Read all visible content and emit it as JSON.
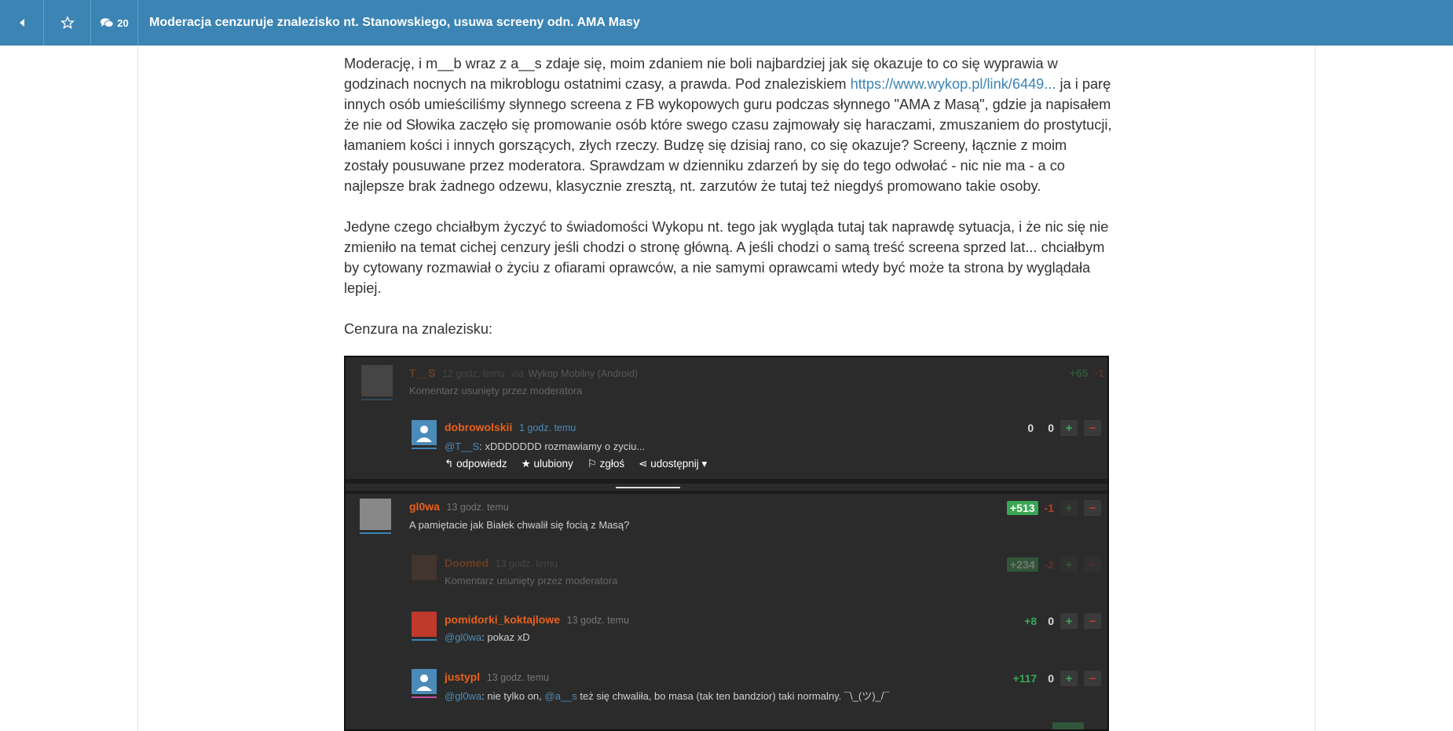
{
  "topbar": {
    "comment_count": "20",
    "title": "Moderacja cenzuruje znalezisko nt. Stanowskiego, usuwa screeny odn. AMA Masy"
  },
  "article": {
    "p1_a": "Moderację, i m__b wraz z a__s zdaje się, moim zdaniem nie boli najbardziej jak się okazuje to co się wyprawia w godzinach nocnych na mikroblogu ostatnimi czasy, a prawda. Pod znaleziskiem ",
    "p1_link": "https://www.wykop.pl/link/6449...",
    "p1_b": " ja i parę innych osób umieściliśmy słynnego screena z FB wykopowych guru podczas słynnego \"AMA z Masą\", gdzie ja napisałem że nie od Słowika zaczęło się promowanie osób które swego czasu zajmowały się haraczami, zmuszaniem do prostytucji, łamaniem kości i innych gorszących, złych rzeczy. Budzę się dzisiaj rano, co się okazuje? Screeny, łącznie z moim zostały pousuwane przez moderatora. Sprawdzam w dzienniku zdarzeń by się do tego odwołać - nic nie ma - a co najlepsze brak żadnego odzewu, klasycznie zresztą, nt. zarzutów że tutaj też niegdyś promowano takie osoby.",
    "p2": "Jedyne czego chciałbym życzyć to świadomości Wykopu nt. tego jak wygląda tutaj tak naprawdę sytuacja, i że nic się nie zmieniło na temat cichej cenzury jeśli chodzi o stronę główną. A jeśli chodzi o samą treść screena sprzed lat... chciałbym by cytowany rozmawiał o życiu z ofiarami oprawców, a nie samymi oprawcami wtedy być może ta strona by wyglądała lepiej.",
    "p3": "Cenzura na znalezisku:"
  },
  "screenshot": {
    "c1": {
      "nick": "T__S",
      "time": "12 godz. temu",
      "via": "via",
      "app": "Wykop Mobilny (Android)",
      "body": "Komentarz usunięty przez moderatora",
      "plus": "+65",
      "minus": "-1"
    },
    "c2": {
      "nick": "dobrowolskii",
      "time": "1 godz. temu",
      "mention": "@T__S",
      "body": ": xDDDDDDD rozmawiamy o zyciu...",
      "plus": "0",
      "minus": "0"
    },
    "actions": {
      "reply": "odpowiedz",
      "fav": "ulubiony",
      "report": "zgłoś",
      "share": "udostępnij"
    },
    "c3": {
      "nick": "gl0wa",
      "time": "13 godz. temu",
      "body": "A pamiętacie jak Białek chwalił się focią z Masą?",
      "plus": "+513",
      "minus": "-1"
    },
    "c4": {
      "nick": "Doomed",
      "time": "13 godz. temu",
      "body": "Komentarz usunięty przez moderatora",
      "plus": "+234",
      "minus": "-2"
    },
    "c5": {
      "nick": "pomidorki_koktajlowe",
      "time": "13 godz. temu",
      "mention": "@gl0wa",
      "body": ": pokaz xD",
      "plus": "+8",
      "minus": "0"
    },
    "c6": {
      "nick": "justypl",
      "time": "13 godz. temu",
      "mention": "@gl0wa",
      "body_a": ": nie tylko on, ",
      "mention2": "@a__s",
      "body_b": " też się chwaliła, bo masa (tak ten bandzior) taki normalny. ¯\\_(ツ)_/¯",
      "plus": "+117",
      "minus": "0"
    }
  }
}
